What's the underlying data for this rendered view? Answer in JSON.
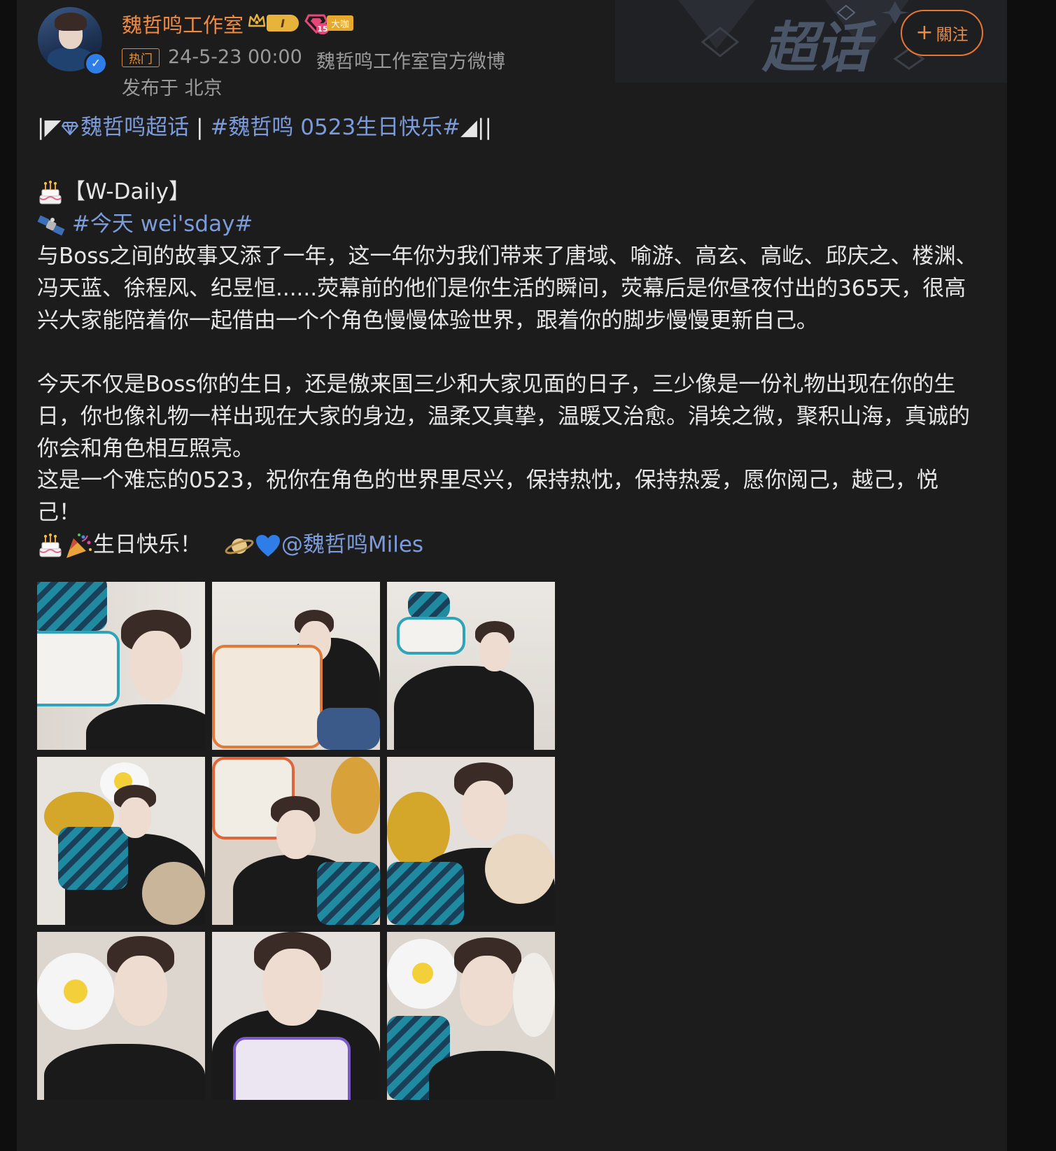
{
  "header": {
    "username": "魏哲鸣工作室",
    "vip_level": "I",
    "fan_level": "15",
    "badge_bigshot": "大咖",
    "hot_label": "热门",
    "timestamp": "24-5-23 00:00",
    "source": "魏哲鸣工作室官方微博",
    "location": "发布于 北京",
    "follow_label": "關注",
    "banner_text": "超话"
  },
  "post": {
    "topic_prefix": "|◤",
    "supertopic": "魏哲鸣超话",
    "separator": " | ",
    "hashtag_birthday": "#魏哲鸣 0523生日快乐#",
    "topic_suffix": "◢||",
    "daily_title": "【W-Daily】",
    "hashtag_weisday": "#今天 wei'sday#",
    "para1": "与Boss之间的故事又添了一年，这一年你为我们带来了唐域、喻游、高玄、高屹、邱庆之、楼渊、冯天蓝、徐程风、纪昱恒......荧幕前的他们是你生活的瞬间，荧幕后是你昼夜付出的365天，很高兴大家能陪着你一起借由一个个角色慢慢体验世界，跟着你的脚步慢慢更新自己。",
    "para2": "今天不仅是Boss你的生日，还是傲来国三少和大家见面的日子，三少像是一份礼物出现在你的生日，你也像礼物一样出现在大家的身边，温柔又真挚，温暖又治愈。涓埃之微，聚积山海，真诚的你会和角色相互照亮。",
    "para3": "这是一个难忘的0523，祝你在角色的世界里尽兴，保持热忱，保持热爱，愿你阅己，越己，悦己！",
    "closing_text": "生日快乐！",
    "mention": "@魏哲鸣Miles"
  },
  "icons": [
    "cake-icon",
    "satellite-icon",
    "party-popper-icon",
    "planet-icon",
    "blue-heart-icon",
    "diamond-icon",
    "crown-icon",
    "verified-icon"
  ],
  "colors": {
    "accent_orange": "#f08a42",
    "link_blue": "#7b9bdb",
    "meta_gray": "#9a9a9a",
    "background": "#1c1c1c"
  }
}
